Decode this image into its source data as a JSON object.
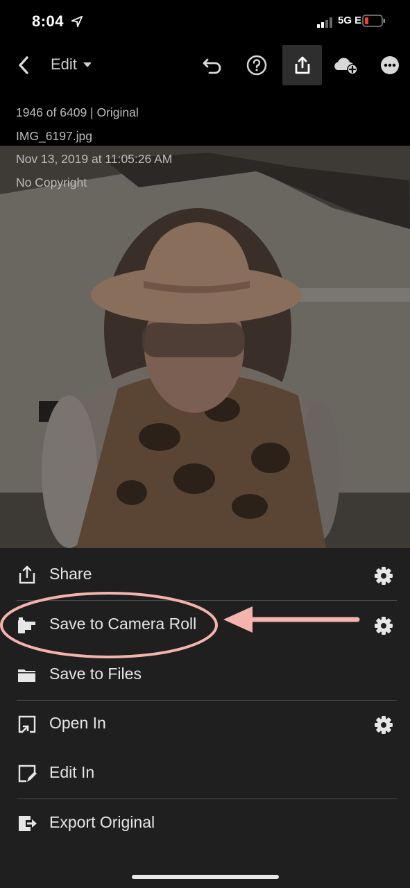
{
  "status_bar": {
    "time": "8:04",
    "network": "5G E"
  },
  "toolbar": {
    "mode_label": "Edit",
    "icons": [
      "back-icon",
      "dropdown-icon",
      "undo-icon",
      "help-icon",
      "share-icon",
      "cloud-add-icon",
      "more-icon"
    ]
  },
  "photo_info": {
    "position": "1946 of 6409 | Original",
    "filename": "IMG_6197.jpg",
    "date": "Nov 13, 2019 at 11:05:26 AM",
    "copyright": "No Copyright"
  },
  "menu": {
    "items": [
      {
        "label": "Share",
        "icon": "share-icon",
        "has_settings": true
      },
      {
        "label": "Save to Camera Roll",
        "icon": "camera-roll-icon",
        "has_settings": true
      },
      {
        "label": "Save to Files",
        "icon": "folder-icon",
        "has_settings": false
      },
      {
        "label": "Open In",
        "icon": "open-in-icon",
        "has_settings": true
      },
      {
        "label": "Edit In",
        "icon": "edit-in-icon",
        "has_settings": false
      },
      {
        "label": "Export Original",
        "icon": "export-icon",
        "has_settings": false
      }
    ]
  },
  "annotation": {
    "color": "#f5b3ad"
  },
  "colors": {
    "sheet_bg": "#1f1f1f",
    "toolbar_active": "#2e2e2e",
    "battery_low": "#ff3b30"
  }
}
